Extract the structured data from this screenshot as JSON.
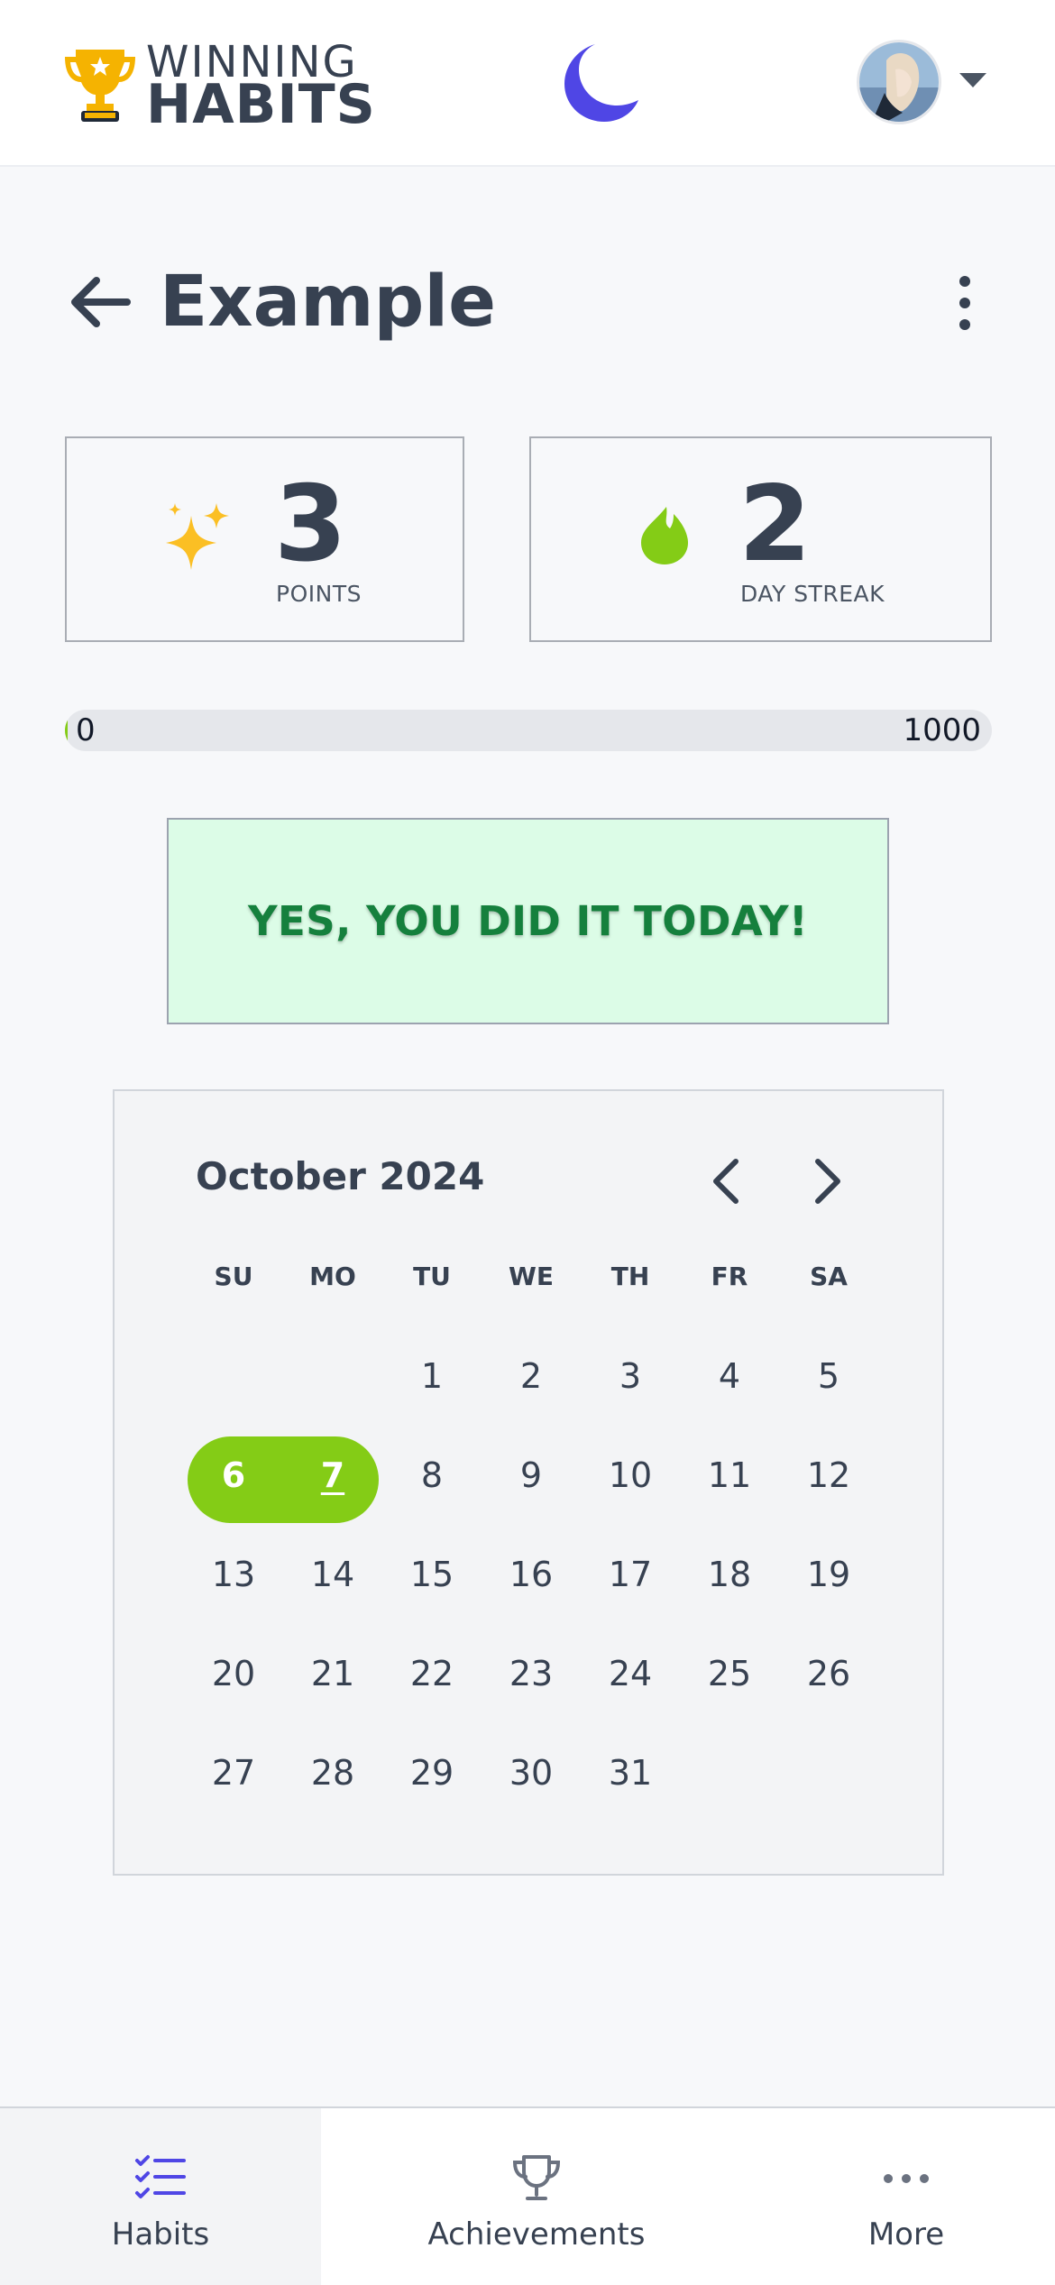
{
  "header": {
    "logo_line1": "WINNING",
    "logo_line2": "HABITS",
    "logo_icon": "trophy-icon",
    "theme_toggle_icon": "moon-icon",
    "avatar_icon": "avatar-image",
    "menu_caret_icon": "caret-down-icon"
  },
  "page": {
    "title": "Example",
    "back_icon": "arrow-left-icon",
    "options_icon": "kebab-menu-icon"
  },
  "stats": {
    "points": {
      "value": "3",
      "label": "POINTS",
      "icon": "sparkles-icon"
    },
    "streak": {
      "value": "2",
      "label": "DAY STREAK",
      "icon": "fire-icon"
    }
  },
  "progress": {
    "min": "0",
    "max": "1000",
    "current": 3
  },
  "done_banner": {
    "text": "YES, YOU DID IT TODAY!"
  },
  "calendar": {
    "month_label": "October 2024",
    "prev_icon": "chevron-left-icon",
    "next_icon": "chevron-right-icon",
    "weekdays": [
      "SU",
      "MO",
      "TU",
      "WE",
      "TH",
      "FR",
      "SA"
    ],
    "weeks": [
      [
        "",
        "",
        "1",
        "2",
        "3",
        "4",
        "5"
      ],
      [
        "6",
        "7",
        "8",
        "9",
        "10",
        "11",
        "12"
      ],
      [
        "13",
        "14",
        "15",
        "16",
        "17",
        "18",
        "19"
      ],
      [
        "20",
        "21",
        "22",
        "23",
        "24",
        "25",
        "26"
      ],
      [
        "27",
        "28",
        "29",
        "30",
        "31",
        "",
        ""
      ]
    ],
    "completed_days": [
      "6",
      "7"
    ],
    "today": "7"
  },
  "bottom_nav": [
    {
      "label": "Habits",
      "icon": "checklist-icon",
      "active": true
    },
    {
      "label": "Achievements",
      "icon": "trophy-outline-icon",
      "active": false
    },
    {
      "label": "More",
      "icon": "more-dots-icon",
      "active": false
    }
  ],
  "colors": {
    "accent": "#84cc16",
    "brand_purple": "#4f46e5",
    "text": "#374151",
    "success_bg": "#dcfce7",
    "success_text": "#15803d"
  }
}
